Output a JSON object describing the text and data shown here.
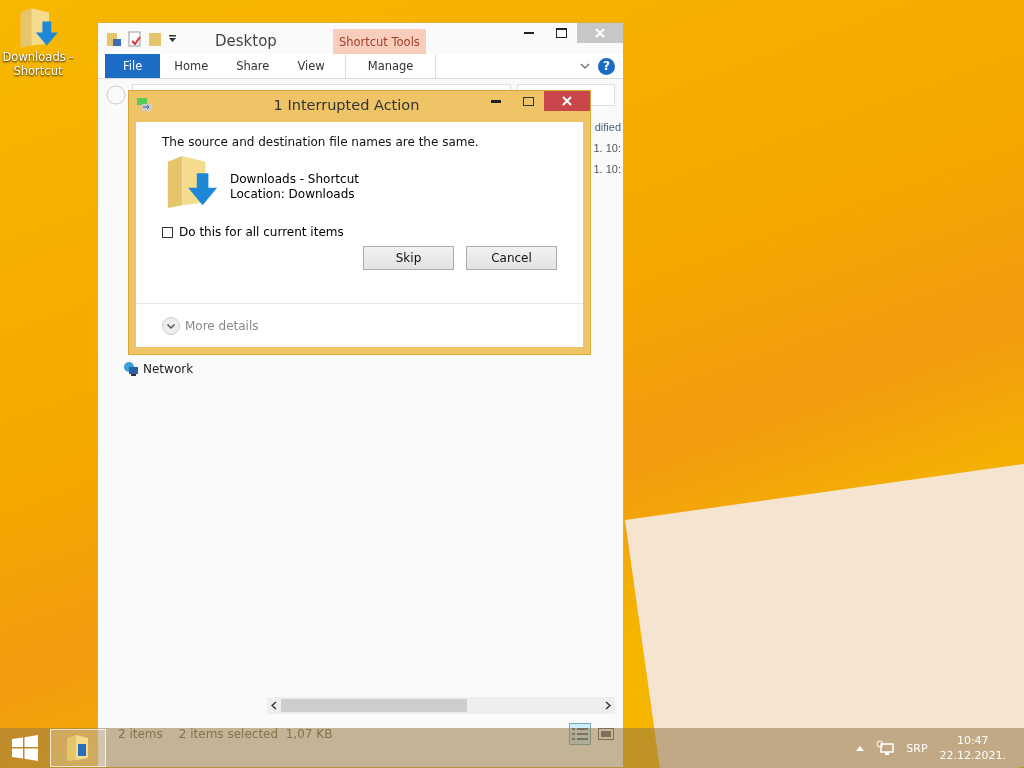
{
  "desktop_icons": [
    {
      "label": "Downloads - Shortcut"
    }
  ],
  "explorer": {
    "title": "Desktop",
    "contextual_group": "Shortcut Tools",
    "ribbon_tabs": [
      {
        "label": "File",
        "kind": "file"
      },
      {
        "label": "Home",
        "kind": "tab"
      },
      {
        "label": "Share",
        "kind": "tab"
      },
      {
        "label": "View",
        "kind": "tab"
      },
      {
        "label": "Manage",
        "kind": "contextual"
      }
    ],
    "help_label": "?",
    "column_3_header": "dified",
    "rows": [
      {
        "column_3": "1. 10:"
      },
      {
        "column_3": "1. 10:"
      }
    ],
    "navigation": [
      {
        "label": "Network"
      }
    ],
    "status": {
      "count": "2 items",
      "selection": "2 items selected",
      "size": "1,07 KB"
    },
    "views": [
      {
        "selected": true
      },
      {
        "selected": false
      }
    ]
  },
  "dialog": {
    "title": "1 Interrupted Action",
    "message": "The source and destination file names are the same.",
    "file_name": "Downloads - Shortcut",
    "location": "Location: Downloads",
    "checkbox": {
      "label": "Do this for all current items",
      "checked": false
    },
    "buttons": [
      "Skip",
      "Cancel"
    ],
    "more_details": "More details"
  },
  "taskbar": {
    "language": "SRP",
    "time": "10:47",
    "date": "22.12.2021."
  }
}
